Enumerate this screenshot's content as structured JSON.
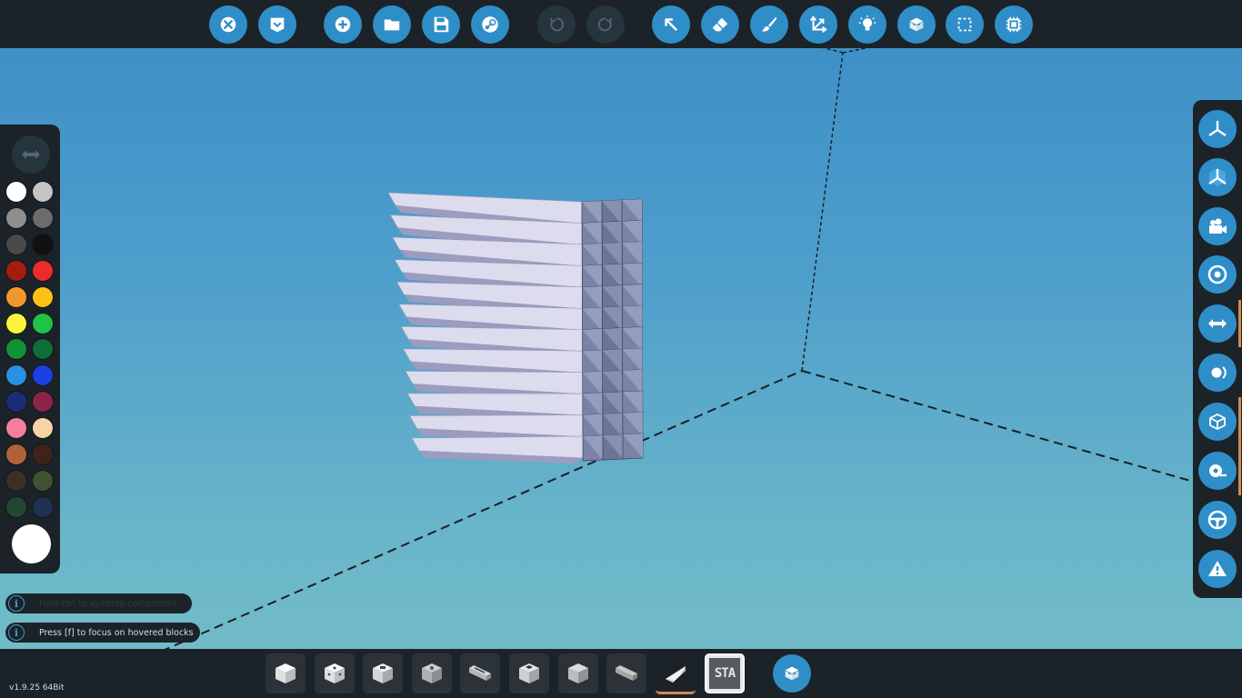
{
  "app": {
    "version": "v1.9.25 64Bit"
  },
  "colors": {
    "accent": "#2f8ec8",
    "panel": "#1c2328",
    "disabled": "#26343d",
    "highlight": "#d18a55"
  },
  "toolbar": {
    "buttons": [
      {
        "name": "close-icon",
        "state": "active"
      },
      {
        "name": "save-menu-icon",
        "state": "active"
      },
      {
        "name": "new-vehicle-icon",
        "state": "active"
      },
      {
        "name": "folder-icon",
        "state": "active"
      },
      {
        "name": "floppy-save-icon",
        "state": "active"
      },
      {
        "name": "steam-icon",
        "state": "active"
      },
      {
        "name": "undo-icon",
        "state": "disabled"
      },
      {
        "name": "redo-icon",
        "state": "disabled"
      },
      {
        "name": "select-arrow-icon",
        "state": "active"
      },
      {
        "name": "eraser-icon",
        "state": "active"
      },
      {
        "name": "paint-brush-icon",
        "state": "active"
      },
      {
        "name": "move-axes-icon",
        "state": "active"
      },
      {
        "name": "light-bulb-icon",
        "state": "active"
      },
      {
        "name": "blocks-icon",
        "state": "active"
      },
      {
        "name": "selection-box-icon",
        "state": "active"
      },
      {
        "name": "microcontroller-icon",
        "state": "active"
      }
    ]
  },
  "palette": {
    "swatches": [
      "#ffffff",
      "#c4c4c4",
      "#8e8e8e",
      "#6c6c6c",
      "#4a4a4a",
      "#111111",
      "#a51d10",
      "#ee2b2b",
      "#f2962e",
      "#fbc215",
      "#f8f53b",
      "#1ec447",
      "#119237",
      "#0e6e38",
      "#2b8fe3",
      "#1b3fe0",
      "#1c2d78",
      "#8e2348",
      "#f47f9c",
      "#f8d3a8",
      "#b2623a",
      "#3f2318",
      "#3b3028",
      "#3f5232",
      "#25462f",
      "#1e3150"
    ],
    "current_color": "#ffffff"
  },
  "right_panel": {
    "buttons": [
      "axis-view-icon",
      "axis-view-solid-icon",
      "camera-icon",
      "target-icon",
      "mirror-arrows-icon",
      "lighting-icon",
      "box-outline-icon",
      "measure-tape-icon",
      "steering-wheel-icon",
      "warning-icon"
    ]
  },
  "hints": [
    {
      "text": "Hold ctrl to eyedrop component",
      "faded": true
    },
    {
      "text": "Press [f] to focus on hovered blocks",
      "faded": false
    }
  ],
  "inventory": {
    "slots": [
      {
        "name": "block-cube-icon",
        "selected": false
      },
      {
        "name": "block-dice-icon",
        "selected": false
      },
      {
        "name": "block-cube-marked-icon",
        "selected": false
      },
      {
        "name": "block-cube-vent-icon",
        "selected": false
      },
      {
        "name": "block-long-slot-icon",
        "selected": false
      },
      {
        "name": "block-cube-dark-icon",
        "selected": false
      },
      {
        "name": "block-cube-grey-icon",
        "selected": false
      },
      {
        "name": "block-long-grey-icon",
        "selected": false
      },
      {
        "name": "block-wedge-icon",
        "selected": true
      },
      {
        "name": "sign-block-icon",
        "selected": false,
        "label": "STA"
      }
    ]
  }
}
